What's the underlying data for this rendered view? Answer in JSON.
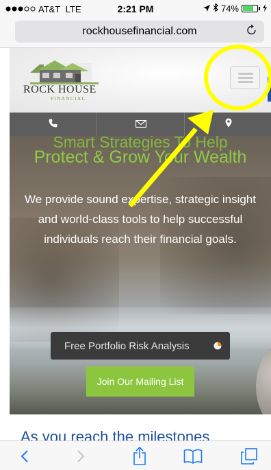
{
  "status_bar": {
    "carrier": "AT&T",
    "network": "LTE",
    "time": "2:21 PM",
    "battery": "74%",
    "battery_level": 0.74,
    "icons": [
      "signal-dots-icon",
      "location-arrow-icon",
      "bluetooth-icon",
      "battery-icon",
      "charging-icon"
    ]
  },
  "browser": {
    "url": "rockhousefinancial.com",
    "reload_icon": "reload-icon"
  },
  "site": {
    "logo_name": "ROCK HOUSE",
    "logo_tagline": "FINANCIAL",
    "menu_icon": "hamburger-menu-icon",
    "contact_icons": [
      "phone-icon",
      "mail-icon",
      "map-pin-icon"
    ]
  },
  "hero": {
    "subtitle_partial": "Smart Strategies To Help",
    "title": "Protect & Grow Your Wealth",
    "body": "We provide sound expertise, strategic insight and world-class tools to help successful individuals reach their financial goals.",
    "risk_button": "Free Portfolio Risk Analysis",
    "mailing_button": "Join Our Mailing List"
  },
  "section": {
    "heading_partial": "As you reach the milestones"
  },
  "toolbar": {
    "icons": [
      "back-icon",
      "forward-icon",
      "share-icon",
      "bookmarks-icon",
      "tabs-icon"
    ]
  },
  "colors": {
    "accent_green": "#8cc63f",
    "annotation_yellow": "#ffff00",
    "ios_blue": "#1a7cf5",
    "heading_blue": "#1e4f9c"
  }
}
